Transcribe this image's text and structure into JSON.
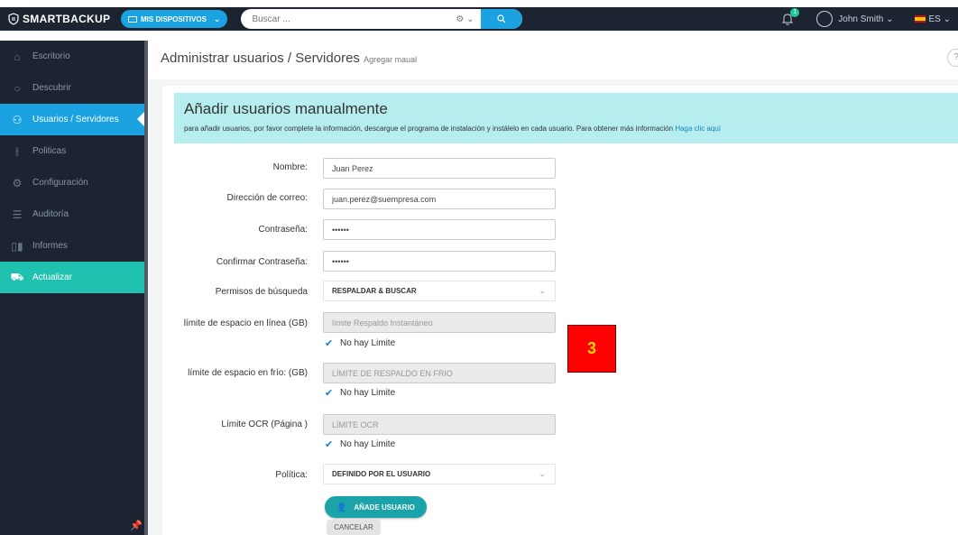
{
  "topbar": {
    "brand": "SMARTBACKUP",
    "devices_label": "MIS DISPOSITIVOS",
    "search_placeholder": "Buscar ...",
    "notifications_count": "1",
    "user_name": "John Smith",
    "language": "ES"
  },
  "sidebar": {
    "items": [
      {
        "label": "Escritorio",
        "icon": "home-icon"
      },
      {
        "label": "Descubrir",
        "icon": "search-icon"
      },
      {
        "label": "Usuarios / Servidores",
        "icon": "users-icon"
      },
      {
        "label": "Politicas",
        "icon": "sliders-icon"
      },
      {
        "label": "Configuración",
        "icon": "gear-icon"
      },
      {
        "label": "Auditoría",
        "icon": "list-icon"
      },
      {
        "label": "Informes",
        "icon": "bar-chart-icon"
      },
      {
        "label": "Actualizar",
        "icon": "cart-icon"
      }
    ],
    "active_index": 2
  },
  "header": {
    "title": "Administrar usuarios / Servidores",
    "subtitle": "Agregar maual"
  },
  "banner": {
    "title": "Añadir usuarios manualmente",
    "text": "para añadir usuarios, por favor complete la información, descargue el programa de instalación y instálelo en cada usuario. Para obtener más información",
    "link": "Haga clic aquí"
  },
  "form": {
    "name_label": "Nombre:",
    "name_value": "Juan Perez",
    "email_label": "Dirección de correo:",
    "email_value": "juan.perez@suempresa.com",
    "password_label": "Contraseña:",
    "password_value": "••••••",
    "confirm_label": "Confirmar Contraseña:",
    "confirm_value": "••••••",
    "search_perm_label": "Permisos de búsqueda",
    "search_perm_value": "RESPALDAR & BUSCAR",
    "online_limit_label": "límite de espacio en línea (GB)",
    "online_limit_placeholder": "límite Respaldo Instantáneo",
    "online_nolimit": "No hay Limite",
    "cold_limit_label": "límite de espacio en frío: (GB)",
    "cold_limit_placeholder": "LÍMITE DE RESPALDO EN FRIO",
    "cold_nolimit": "No hay Limite",
    "ocr_label": "Límite OCR (Página )",
    "ocr_placeholder": "LÍMITE OCR",
    "ocr_nolimit": "No hay Limite",
    "policy_label": "Política:",
    "policy_value": "DEFINIDO POR EL USUARIO",
    "add_button": "AÑADE USUARIO",
    "cancel_button": "CANCELAR"
  },
  "step_marker": "3",
  "colors": {
    "sidebar_bg": "#1b2430",
    "accent": "#1aa3e0",
    "update_bg": "#20c1b0",
    "banner_bg": "#b6eef0",
    "marker_bg": "#ff0000",
    "marker_text": "#ffd400"
  }
}
